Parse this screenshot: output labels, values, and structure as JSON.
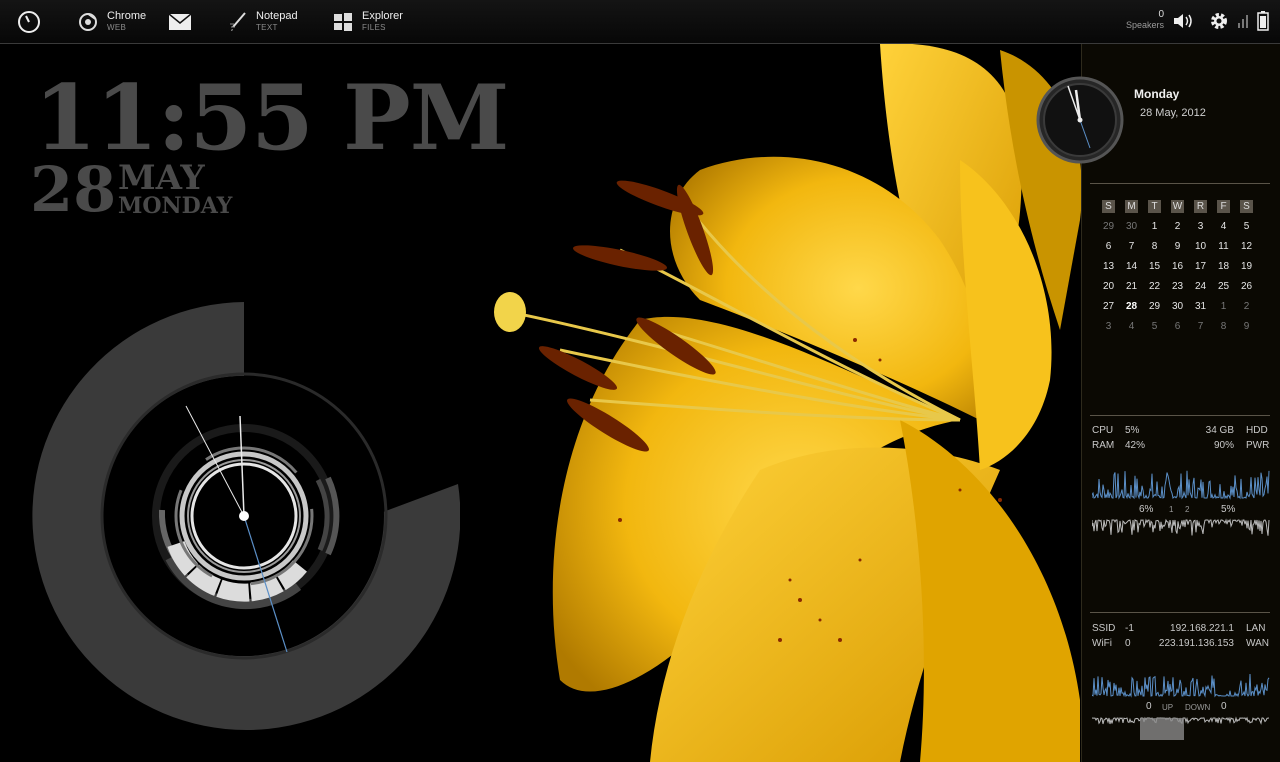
{
  "taskbar": {
    "launchers": [
      {
        "name": "Chrome",
        "sub": "WEB"
      },
      {
        "name": "Notepad",
        "sub": "TEXT"
      },
      {
        "name": "Explorer",
        "sub": "FILES"
      }
    ],
    "speakers_value": "0",
    "speakers_label": "Speakers"
  },
  "clock": {
    "time": "11:55 PM",
    "day": "28",
    "month": "MAY",
    "weekday": "MONDAY"
  },
  "panel": {
    "weekday": "Monday",
    "date": "28 May, 2012",
    "calendar": {
      "headers": [
        "S",
        "M",
        "T",
        "W",
        "R",
        "F",
        "S"
      ],
      "weeks": [
        [
          "29",
          "30",
          "1",
          "2",
          "3",
          "4",
          "5"
        ],
        [
          "6",
          "7",
          "8",
          "9",
          "10",
          "11",
          "12"
        ],
        [
          "13",
          "14",
          "15",
          "16",
          "17",
          "18",
          "19"
        ],
        [
          "20",
          "21",
          "22",
          "23",
          "24",
          "25",
          "26"
        ],
        [
          "27",
          "28",
          "29",
          "30",
          "31",
          "1",
          "2"
        ],
        [
          "3",
          "4",
          "5",
          "6",
          "7",
          "8",
          "9"
        ]
      ]
    },
    "system": {
      "cpu_label": "CPU",
      "cpu_value": "5%",
      "ram_label": "RAM",
      "ram_value": "42%",
      "hdd_value": "34 GB",
      "hdd_label": "HDD",
      "pwr_value": "90%",
      "pwr_label": "PWR",
      "core1_value": "6%",
      "core1_label": "1",
      "core2_label": "2",
      "core2_value": "5%"
    },
    "network": {
      "ssid_label": "SSID",
      "ssid_value": "-1",
      "wifi_label": "WiFi",
      "wifi_value": "0",
      "lan_ip": "192.168.221.1",
      "lan_label": "LAN",
      "wan_ip": "223.191.136.153",
      "wan_label": "WAN",
      "up_value": "0",
      "up_label": "UP",
      "down_label": "DOWN",
      "down_value": "0"
    }
  },
  "colors": {
    "flower": "#f2b70f",
    "clock_gray": "#4a4a4a",
    "ring_gray": "#3a3a3a",
    "graph_blue": "#5b8fc7"
  }
}
